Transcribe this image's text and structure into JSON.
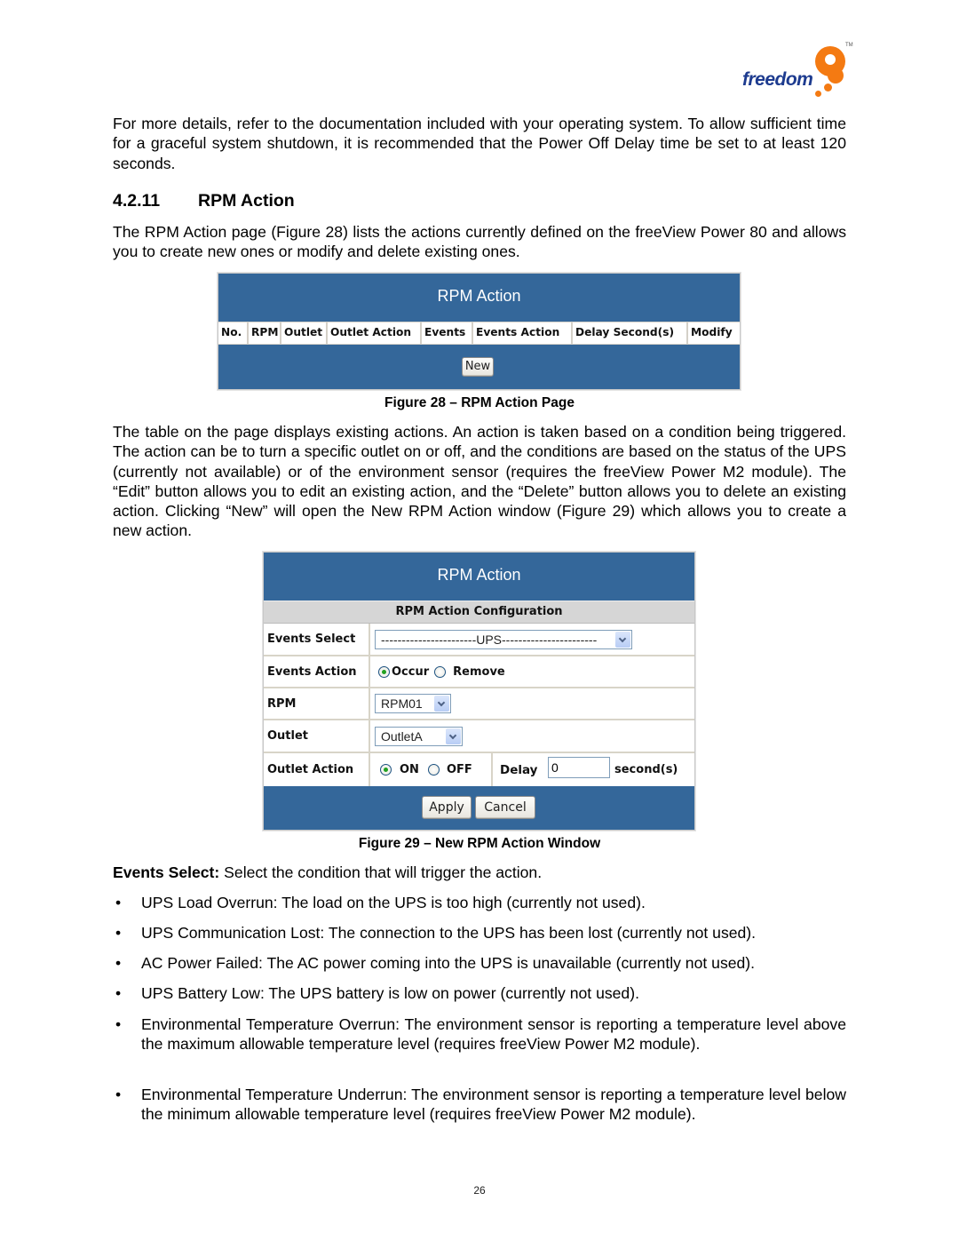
{
  "logo": {
    "word": "freedom",
    "mark": "9",
    "tm": "TM"
  },
  "intro_paragraph": "For more details, refer to the documentation included with your operating system. To allow sufficient time for a graceful system shutdown, it is recommended that the Power Off Delay time be set to at least 120 seconds.",
  "section": {
    "number": "4.2.11",
    "title": "RPM Action"
  },
  "section_paragraph": "The RPM Action page (Figure 28) lists the actions currently defined on the freeView Power 80 and allows you to create new ones or modify and delete existing ones.",
  "figure28": {
    "panel_title": "RPM Action",
    "columns": [
      "No.",
      "RPM",
      "Outlet",
      "Outlet Action",
      "Events",
      "Events Action",
      "Delay Second(s)",
      "Modify"
    ],
    "new_button": "New",
    "caption": "Figure 28 – RPM Action Page"
  },
  "table_paragraph": "The table on the page displays existing actions. An action is taken based on a condition being triggered. The action can be to turn a specific outlet on or off, and the conditions are based on the status of the UPS (currently not available) or of the environment sensor (requires the freeView Power M2 module). The “Edit” button allows you to edit an existing action, and the “Delete” button allows you to delete an existing action. Clicking “New” will open the New RPM Action window (Figure 29) which allows you to create a new action.",
  "figure29": {
    "panel_title": "RPM Action",
    "config_header": "RPM Action Configuration",
    "rows": {
      "events_select": {
        "label": "Events Select",
        "value": "-----------------------UPS-----------------------"
      },
      "events_action": {
        "label": "Events Action",
        "options": [
          "Occur",
          "Remove"
        ],
        "selected": "Occur"
      },
      "rpm": {
        "label": "RPM",
        "value": "RPM01"
      },
      "outlet": {
        "label": "Outlet",
        "value": "OutletA"
      },
      "outlet_action": {
        "label": "Outlet Action",
        "options": [
          "ON",
          "OFF"
        ],
        "selected": "ON",
        "delay_label": "Delay",
        "delay_value": "0",
        "delay_unit": "second(s)"
      }
    },
    "apply_button": "Apply",
    "cancel_button": "Cancel",
    "caption": "Figure 29 – New RPM Action Window"
  },
  "events_select_desc": {
    "term": "Events Select:",
    "text": " Select the condition that will trigger the action."
  },
  "bullets": [
    "UPS Load Overrun: The load on the UPS is too high (currently not used).",
    "UPS Communication Lost: The connection to the UPS has been lost (currently not used).",
    "AC Power Failed: The AC power coming into the UPS is unavailable (currently not used).",
    "UPS Battery Low: The UPS battery is low on power (currently not used).",
    "Environmental Temperature Overrun: The environment sensor is reporting a temperature level above the maximum allowable temperature level (requires freeView Power M2 module).",
    "Environmental Temperature Underrun: The environment sensor is reporting a temperature level below the minimum allowable temperature level (requires freeView Power M2 module)."
  ],
  "bullet_glyph": "•",
  "page_number": "26",
  "colors": {
    "panel_blue": "#34679a",
    "logo_orange": "#f47a12",
    "logo_blue": "#1d3b8f"
  }
}
